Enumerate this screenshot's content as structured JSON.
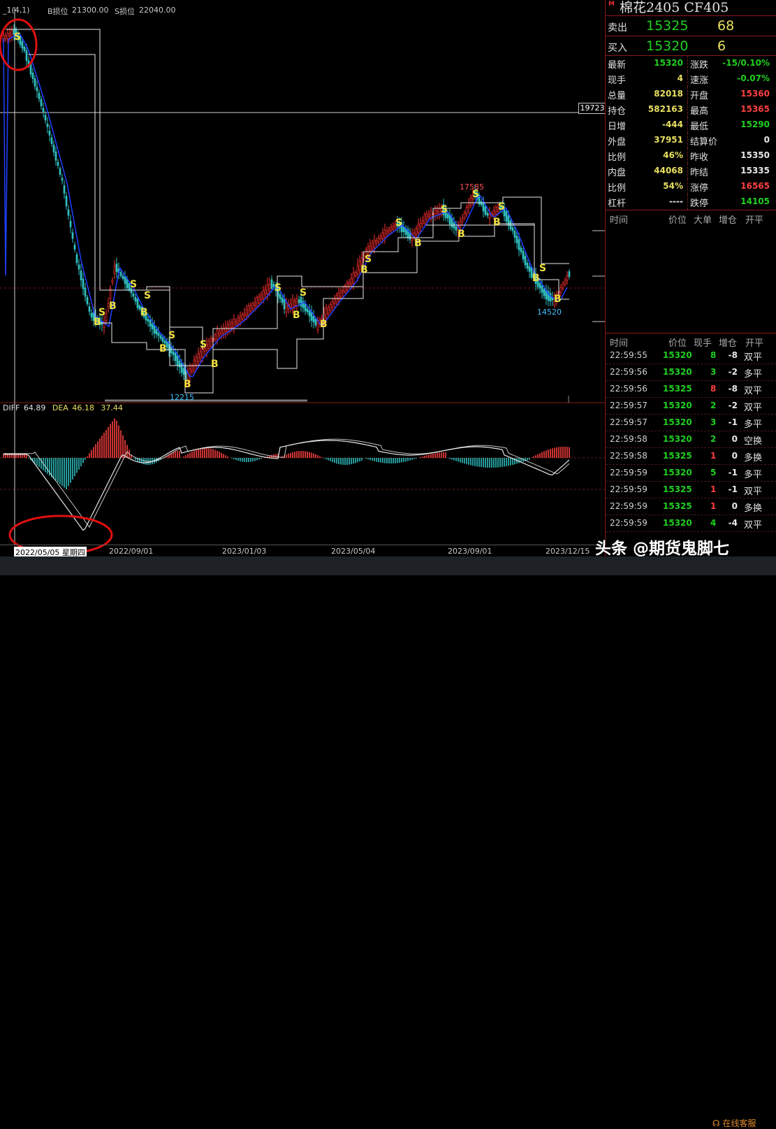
{
  "topbar": {
    "indicator": "_1(4,1)",
    "b_stop_label": "B损位",
    "b_stop": "21300.00",
    "s_stop_label": "S损位",
    "s_stop": "22040.00"
  },
  "price_tag": "19723",
  "chart_labels": {
    "high": "17585",
    "low1": "12215",
    "low2": "14520"
  },
  "macd": {
    "diff_label": "DIFF",
    "diff": "64.89",
    "dea_label": "DEA",
    "dea": "46.18",
    "macd": "37.44"
  },
  "xaxis": [
    "2022/05/05 星期四",
    "2022/09/01",
    "2023/01/03",
    "2023/05/04",
    "2023/09/01",
    "2023/12/15"
  ],
  "panel": {
    "title": "棉花2405  CF405",
    "badge": "M",
    "sell": {
      "label": "卖出",
      "price": "15325",
      "volume": "68"
    },
    "buy": {
      "label": "买入",
      "price": "15320",
      "volume": "6"
    },
    "stats": [
      {
        "l1": "最新",
        "v1": "15320",
        "c1": "#20d020",
        "l2": "涨跌",
        "v2": "-15/0.10%",
        "c2": "#20d020"
      },
      {
        "l1": "现手",
        "v1": "4",
        "c1": "#e8e060",
        "l2": "速涨",
        "v2": "-0.07%",
        "c2": "#20d020"
      },
      {
        "l1": "总量",
        "v1": "82018",
        "c1": "#e8e060",
        "l2": "开盘",
        "v2": "15360",
        "c2": "#ff4040"
      },
      {
        "l1": "持仓",
        "v1": "582163",
        "c1": "#e8e060",
        "l2": "最高",
        "v2": "15365",
        "c2": "#ff4040"
      },
      {
        "l1": "日增",
        "v1": "-444",
        "c1": "#e8e060",
        "l2": "最低",
        "v2": "15290",
        "c2": "#20d020"
      },
      {
        "l1": "外盘",
        "v1": "37951",
        "c1": "#e8e060",
        "l2": "结算价",
        "v2": "0",
        "c2": "#e8e8e8"
      },
      {
        "l1": "比例",
        "v1": "46%",
        "c1": "#e8e060",
        "l2": "昨收",
        "v2": "15350",
        "c2": "#e8e8e8"
      },
      {
        "l1": "内盘",
        "v1": "44068",
        "c1": "#e8e060",
        "l2": "昨结",
        "v2": "15335",
        "c2": "#e8e8e8"
      },
      {
        "l1": "比例",
        "v1": "54%",
        "c1": "#e8e060",
        "l2": "涨停",
        "v2": "16565",
        "c2": "#ff4040"
      },
      {
        "l1": "杠杆",
        "v1": "----",
        "c1": "#e8e8e8",
        "l2": "跌停",
        "v2": "14105",
        "c2": "#20d020"
      }
    ],
    "big_header": {
      "time": "时间",
      "price": "价位",
      "big": "大单",
      "oi": "增仓",
      "kp": "开平"
    },
    "tick_header": {
      "time": "时间",
      "price": "价位",
      "vol": "现手",
      "oi": "增仓",
      "kp": "开平"
    },
    "ticks": [
      {
        "t": "22:59:55",
        "p": "15320",
        "v": "8",
        "vc": "#20d020",
        "d": "-8",
        "k": "双平"
      },
      {
        "t": "22:59:56",
        "p": "15320",
        "v": "3",
        "vc": "#20d020",
        "d": "-2",
        "k": "多平"
      },
      {
        "t": "22:59:56",
        "p": "15325",
        "v": "8",
        "vc": "#ff4040",
        "d": "-8",
        "k": "双平"
      },
      {
        "t": "22:59:57",
        "p": "15320",
        "v": "2",
        "vc": "#20d020",
        "d": "-2",
        "k": "双平"
      },
      {
        "t": "22:59:57",
        "p": "15320",
        "v": "3",
        "vc": "#20d020",
        "d": "-1",
        "k": "多平"
      },
      {
        "t": "22:59:58",
        "p": "15320",
        "v": "2",
        "vc": "#20d020",
        "d": "0",
        "k": "空换"
      },
      {
        "t": "22:59:58",
        "p": "15325",
        "v": "1",
        "vc": "#ff4040",
        "d": "0",
        "k": "多换"
      },
      {
        "t": "22:59:59",
        "p": "15320",
        "v": "5",
        "vc": "#20d020",
        "d": "-1",
        "k": "多平"
      },
      {
        "t": "22:59:59",
        "p": "15325",
        "v": "1",
        "vc": "#ff4040",
        "d": "-1",
        "k": "双平"
      },
      {
        "t": "22:59:59",
        "p": "15325",
        "v": "1",
        "vc": "#ff4040",
        "d": "0",
        "k": "多换"
      },
      {
        "t": "22:59:59",
        "p": "15320",
        "v": "4",
        "vc": "#20d020",
        "d": "-4",
        "k": "双平"
      }
    ]
  },
  "watermark": "头条 @期货鬼脚七",
  "service": "在线客服",
  "colors": {
    "up": "#ff4040",
    "down": "#20d020",
    "signal": "#f0e040",
    "frame": "#8a1a1a"
  }
}
